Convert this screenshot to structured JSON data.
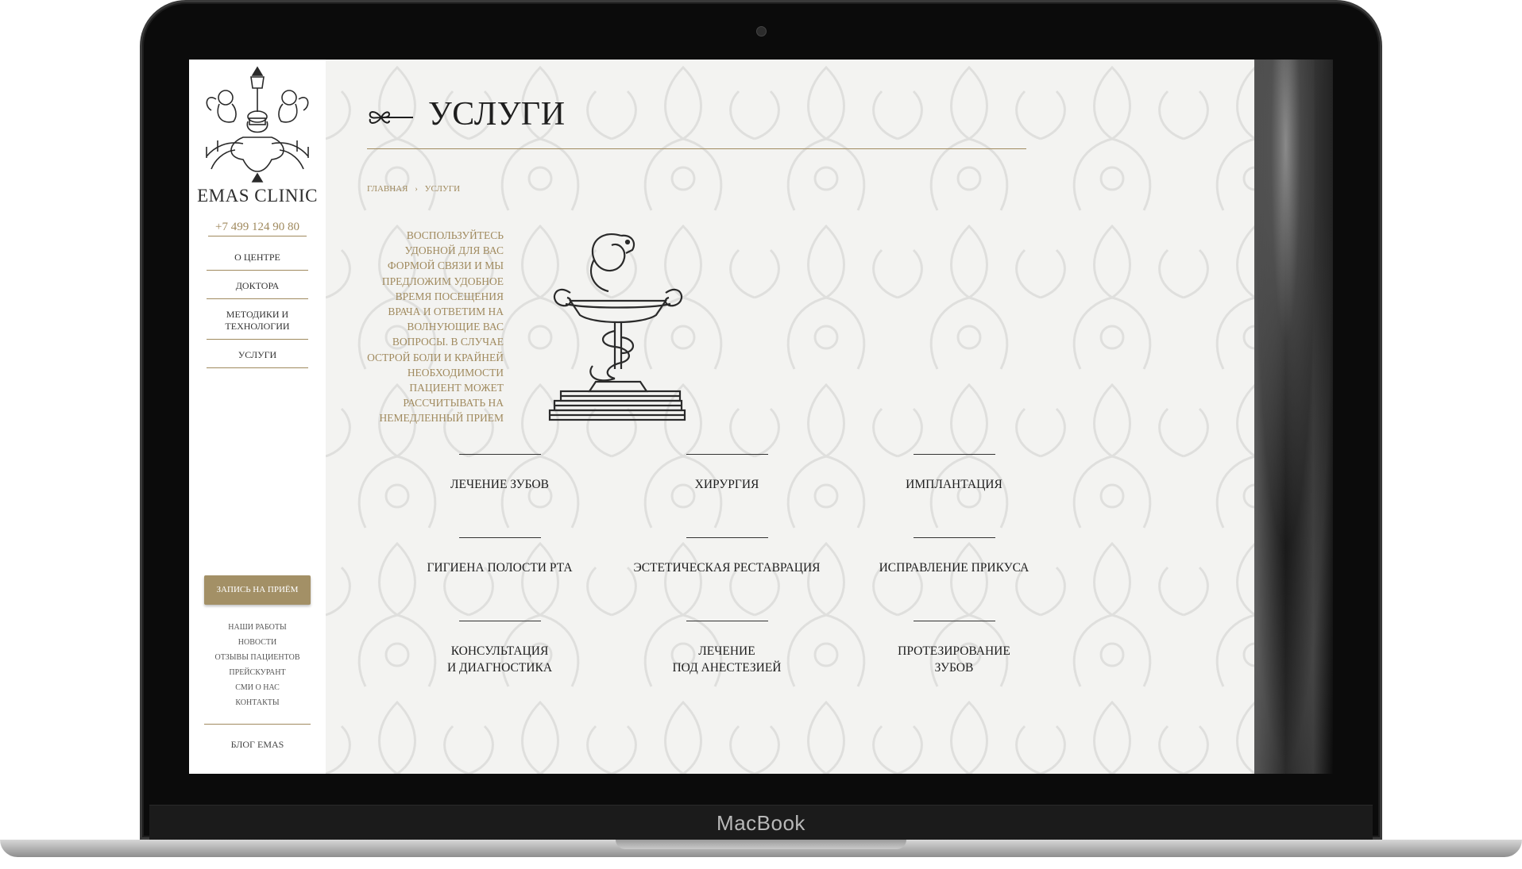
{
  "device": {
    "brand_label": "MacBook"
  },
  "sidebar": {
    "clinic_name": "EMAS CLINIC",
    "phone": "+7 499 124 90 80",
    "main_nav": [
      {
        "label": "О ЦЕНТРЕ"
      },
      {
        "label": "ДОКТОРА"
      },
      {
        "label": "МЕТОДИКИ И ТЕХНОЛОГИИ"
      },
      {
        "label": "УСЛУГИ"
      }
    ],
    "cta_label": "ЗАПИСЬ НА ПРИЁМ",
    "secondary_nav": [
      {
        "label": "НАШИ РАБОТЫ"
      },
      {
        "label": "НОВОСТИ"
      },
      {
        "label": "ОТЗЫВЫ ПАЦИЕНТОВ"
      },
      {
        "label": "ПРЕЙСКУРАНТ"
      },
      {
        "label": "СМИ О НАС"
      },
      {
        "label": "КОНТАКТЫ"
      }
    ],
    "blog_label": "БЛОГ EMAS"
  },
  "main": {
    "title": "УСЛУГИ",
    "breadcrumb": {
      "home": "ГЛАВНАЯ",
      "separator": "›",
      "current": "УСЛУГИ"
    },
    "intro_text": "ВОСПОЛЬЗУЙТЕСЬ УДОБНОЙ ДЛЯ ВАС ФОРМОЙ СВЯЗИ И МЫ ПРЕДЛОЖИМ УДОБНОЕ ВРЕМЯ ПОСЕЩЕНИЯ ВРАЧА И ОТВЕТИМ НА ВОЛНУЮЩИЕ ВАС ВОПРОСЫ. В СЛУЧАЕ ОСТРОЙ БОЛИ И КРАЙНЕЙ НЕОБХОДИМОСТИ ПАЦИЕНТ МОЖЕТ РАССЧИТЫВАТЬ НА НЕМЕДЛЕННЫЙ ПРИЕМ",
    "services": [
      {
        "label": "ЛЕЧЕНИЕ ЗУБОВ"
      },
      {
        "label": "ХИРУРГИЯ"
      },
      {
        "label": "ИМПЛАНТАЦИЯ"
      },
      {
        "label": "ГИГИЕНА ПОЛОСТИ РТА"
      },
      {
        "label": "ЭСТЕТИЧЕСКАЯ РЕСТАВРАЦИЯ"
      },
      {
        "label": "ИСПРАВЛЕНИЕ ПРИКУСА"
      },
      {
        "label": "КОНСУЛЬТАЦИЯ\nИ ДИАГНОСТИКА"
      },
      {
        "label": "ЛЕЧЕНИЕ\nПОД АНЕСТЕЗИЕЙ"
      },
      {
        "label": "ПРОТЕЗИРОВАНИЕ\nЗУБОВ"
      }
    ]
  },
  "colors": {
    "accent_gold": "#a08a5e",
    "button_gold": "#a39066",
    "text_dark": "#1e1e1e",
    "background": "#f3f3f1"
  },
  "icons": {
    "logo": "chandelier-cherubs-logo",
    "title_ornament": "fleur-flourish-icon",
    "emblem": "bowl-of-hygieia-books-icon"
  }
}
